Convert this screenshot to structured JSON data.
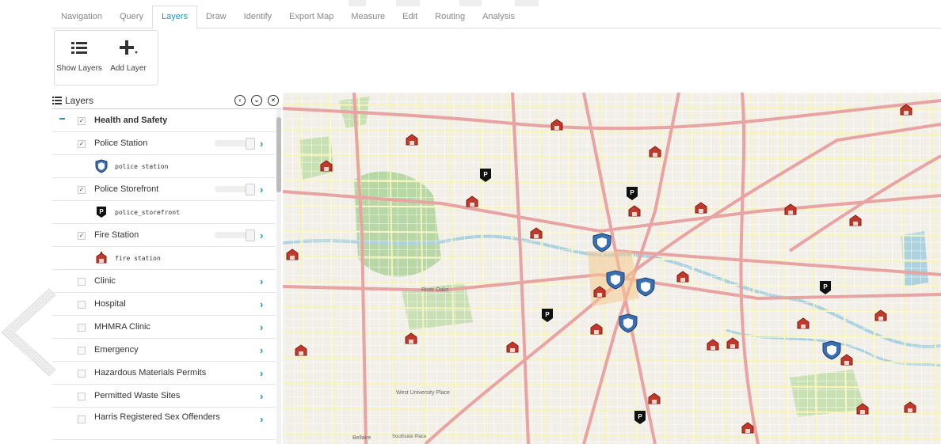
{
  "tabs": [
    {
      "label": "Navigation",
      "active": false
    },
    {
      "label": "Query",
      "active": false
    },
    {
      "label": "Layers",
      "active": true
    },
    {
      "label": "Draw",
      "active": false
    },
    {
      "label": "Identify",
      "active": false
    },
    {
      "label": "Export Map",
      "active": false
    },
    {
      "label": "Measure",
      "active": false
    },
    {
      "label": "Edit",
      "active": false
    },
    {
      "label": "Routing",
      "active": false
    },
    {
      "label": "Analysis",
      "active": false
    }
  ],
  "toolbar": {
    "show_layers_label": "Show Layers",
    "add_layer_label": "Add Layer"
  },
  "panel": {
    "title": "Layers",
    "rows": [
      {
        "kind": "group",
        "label": "Health and Safety",
        "checked": true
      },
      {
        "kind": "layer",
        "label": "Police Station",
        "checked": true,
        "slider": true
      },
      {
        "kind": "legend",
        "label": "police station",
        "icon": "police-shield-icon"
      },
      {
        "kind": "layer",
        "label": "Police Storefront",
        "checked": true,
        "slider": true
      },
      {
        "kind": "legend",
        "label": "police_storefront",
        "icon": "police-storefront-icon"
      },
      {
        "kind": "layer",
        "label": "Fire Station",
        "checked": true,
        "slider": true
      },
      {
        "kind": "legend",
        "label": "fire station",
        "icon": "fire-station-icon"
      },
      {
        "kind": "layer",
        "label": "Clinic",
        "checked": false,
        "slider": false
      },
      {
        "kind": "layer",
        "label": "Hospital",
        "checked": false,
        "slider": false
      },
      {
        "kind": "layer",
        "label": "MHMRA Clinic",
        "checked": false,
        "slider": false
      },
      {
        "kind": "layer",
        "label": "Emergency",
        "checked": false,
        "slider": false
      },
      {
        "kind": "layer",
        "label": "Hazardous Materials Permits",
        "checked": false,
        "slider": false
      },
      {
        "kind": "layer",
        "label": "Permitted Waste Sites",
        "checked": false,
        "slider": false
      },
      {
        "kind": "layer",
        "label": "Harris Registered Sex Offenders",
        "checked": false,
        "slider": false,
        "tall": true
      }
    ]
  },
  "map": {
    "place_labels": [
      "River Oaks",
      "West University Place",
      "Bellaire",
      "Southside Place"
    ],
    "colors": {
      "major_road": "#e8a3a3",
      "minor_road": "#f7f4b8",
      "park": "#b7d8a4",
      "water": "#aad3df",
      "land": "#f2efe9"
    }
  }
}
